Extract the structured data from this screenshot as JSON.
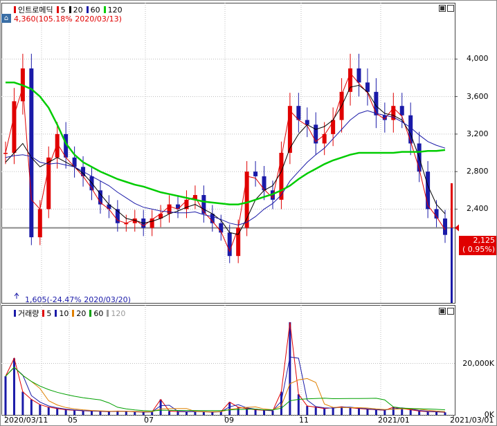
{
  "chart_data": [
    {
      "type": "candlestick",
      "title": "인트로메딕",
      "legend": [
        {
          "label": "인트로메딕",
          "color": "#e00000"
        },
        {
          "label": "5",
          "color": "#e00000"
        },
        {
          "label": "20",
          "color": "#000000"
        },
        {
          "label": "60",
          "color": "#1a1aa8"
        },
        {
          "label": "120",
          "color": "#00cc00"
        }
      ],
      "high_annotation": "4,360(105.18% 2020/03/13)",
      "low_annotation": "1,605(-24.47% 2020/03/20)",
      "current_price": "2,125",
      "current_change": "( 0.95%)",
      "reference_price": 2200,
      "ylim": [
        1400,
        4600
      ],
      "yticks": [
        {
          "value": 4000,
          "label": "4,000"
        },
        {
          "value": 3600,
          "label": "3,600"
        },
        {
          "value": 3200,
          "label": "3,200"
        },
        {
          "value": 2800,
          "label": "2,800"
        },
        {
          "value": 2400,
          "label": "2,400"
        }
      ],
      "x": [
        "2020-03-02",
        "2020-03-09",
        "2020-03-16",
        "2020-03-23",
        "2020-03-30",
        "2020-04-06",
        "2020-04-13",
        "2020-04-20",
        "2020-04-27",
        "2020-05-04",
        "2020-05-11",
        "2020-05-18",
        "2020-05-25",
        "2020-06-01",
        "2020-06-08",
        "2020-06-15",
        "2020-06-22",
        "2020-06-29",
        "2020-07-06",
        "2020-07-13",
        "2020-07-20",
        "2020-07-27",
        "2020-08-03",
        "2020-08-10",
        "2020-08-17",
        "2020-08-24",
        "2020-08-31",
        "2020-09-07",
        "2020-09-14",
        "2020-09-21",
        "2020-09-28",
        "2020-10-05",
        "2020-10-12",
        "2020-10-19",
        "2020-10-26",
        "2020-11-02",
        "2020-11-09",
        "2020-11-16",
        "2020-11-23",
        "2020-11-30",
        "2020-12-07",
        "2020-12-14",
        "2020-12-21",
        "2020-12-28",
        "2021-01-04",
        "2021-01-11",
        "2021-01-18",
        "2021-01-25",
        "2021-02-01",
        "2021-02-08",
        "2021-02-15",
        "2021-02-22"
      ],
      "series": [
        {
          "name": "price",
          "values": [
            3000,
            3550,
            3900,
            2100,
            2400,
            2950,
            3200,
            2950,
            2850,
            2750,
            2600,
            2450,
            2400,
            2250,
            2250,
            2300,
            2200,
            2300,
            2350,
            2450,
            2400,
            2500,
            2550,
            2350,
            2250,
            2150,
            1900,
            2200,
            2800,
            2750,
            2600,
            2500,
            3000,
            3500,
            3350,
            3300,
            3100,
            3200,
            3350,
            3650,
            3900,
            3750,
            3650,
            3400,
            3350,
            3500,
            3400,
            3100,
            2800,
            2400,
            2300,
            2125
          ]
        },
        {
          "name": "5",
          "values": [
            3000,
            3400,
            3700,
            2500,
            2400,
            2850,
            3100,
            2950,
            2850,
            2750,
            2620,
            2470,
            2400,
            2280,
            2250,
            2290,
            2220,
            2290,
            2350,
            2430,
            2400,
            2490,
            2530,
            2370,
            2270,
            2160,
            1950,
            2200,
            2750,
            2730,
            2610,
            2520,
            2950,
            3450,
            3350,
            3290,
            3120,
            3190,
            3330,
            3620,
            3850,
            3740,
            3640,
            3420,
            3360,
            3480,
            3390,
            3120,
            2830,
            2440,
            2320,
            2180
          ]
        },
        {
          "name": "20",
          "values": [
            2900,
            3000,
            3100,
            2950,
            2850,
            2900,
            2950,
            2900,
            2850,
            2780,
            2680,
            2560,
            2450,
            2380,
            2300,
            2280,
            2250,
            2270,
            2300,
            2350,
            2380,
            2420,
            2450,
            2400,
            2350,
            2280,
            2150,
            2130,
            2300,
            2500,
            2600,
            2650,
            2800,
            3050,
            3200,
            3300,
            3250,
            3280,
            3350,
            3500,
            3700,
            3720,
            3650,
            3500,
            3420,
            3400,
            3350,
            3200,
            2950,
            2650,
            2450,
            2350
          ]
        },
        {
          "name": "60",
          "values": [
            2950,
            2970,
            2980,
            2960,
            2900,
            2880,
            2890,
            2870,
            2850,
            2800,
            2750,
            2700,
            2650,
            2580,
            2520,
            2460,
            2420,
            2400,
            2380,
            2370,
            2360,
            2360,
            2370,
            2340,
            2320,
            2290,
            2250,
            2230,
            2260,
            2320,
            2400,
            2460,
            2550,
            2700,
            2800,
            2900,
            2980,
            3050,
            3150,
            3250,
            3350,
            3420,
            3450,
            3420,
            3400,
            3380,
            3330,
            3270,
            3190,
            3120,
            3080,
            3050
          ]
        },
        {
          "name": "120",
          "values": [
            3750,
            3750,
            3720,
            3680,
            3600,
            3480,
            3300,
            3100,
            2980,
            2900,
            2850,
            2800,
            2760,
            2720,
            2690,
            2660,
            2640,
            2610,
            2580,
            2560,
            2540,
            2520,
            2500,
            2480,
            2470,
            2460,
            2450,
            2450,
            2470,
            2500,
            2530,
            2560,
            2600,
            2650,
            2720,
            2780,
            2830,
            2880,
            2920,
            2950,
            2980,
            3000,
            3000,
            3000,
            3000,
            3000,
            3010,
            3010,
            3010,
            3020,
            3020,
            3030
          ]
        }
      ]
    },
    {
      "type": "bar",
      "title": "거래량",
      "legend": [
        {
          "label": "거래량",
          "color": "#1a1aa8"
        },
        {
          "label": "5",
          "color": "#e00000"
        },
        {
          "label": "10",
          "color": "#1a1aa8"
        },
        {
          "label": "20",
          "color": "#e08000"
        },
        {
          "label": "60",
          "color": "#00a000"
        },
        {
          "label": "120",
          "color": "#999999"
        }
      ],
      "ylim": [
        0,
        40000
      ],
      "yticks": [
        {
          "value": 20000,
          "label": "20,000K"
        },
        {
          "value": 0,
          "label": "0K"
        }
      ],
      "values": [
        15000,
        22000,
        9000,
        6000,
        4000,
        3000,
        2500,
        2000,
        1800,
        1600,
        1500,
        1400,
        1300,
        1500,
        1400,
        1200,
        1100,
        1200,
        6000,
        1500,
        1300,
        1200,
        1400,
        1200,
        1100,
        1300,
        5000,
        3000,
        2500,
        2000,
        1800,
        1600,
        9000,
        36000,
        8000,
        3500,
        3000,
        2500,
        2800,
        3200,
        2800,
        2500,
        2200,
        2000,
        1800,
        3000,
        2500,
        2000,
        1500,
        1300,
        1200,
        1000
      ]
    }
  ],
  "x_axis": {
    "labels": [
      "2020/03/11",
      "05",
      "07",
      "09",
      "11",
      "2021/01",
      "2021/03/01"
    ]
  },
  "colors": {
    "up": "#e00000",
    "down": "#1a1aa8",
    "grid": "#bcbcbc",
    "reference_line": "#8a8a8a"
  }
}
